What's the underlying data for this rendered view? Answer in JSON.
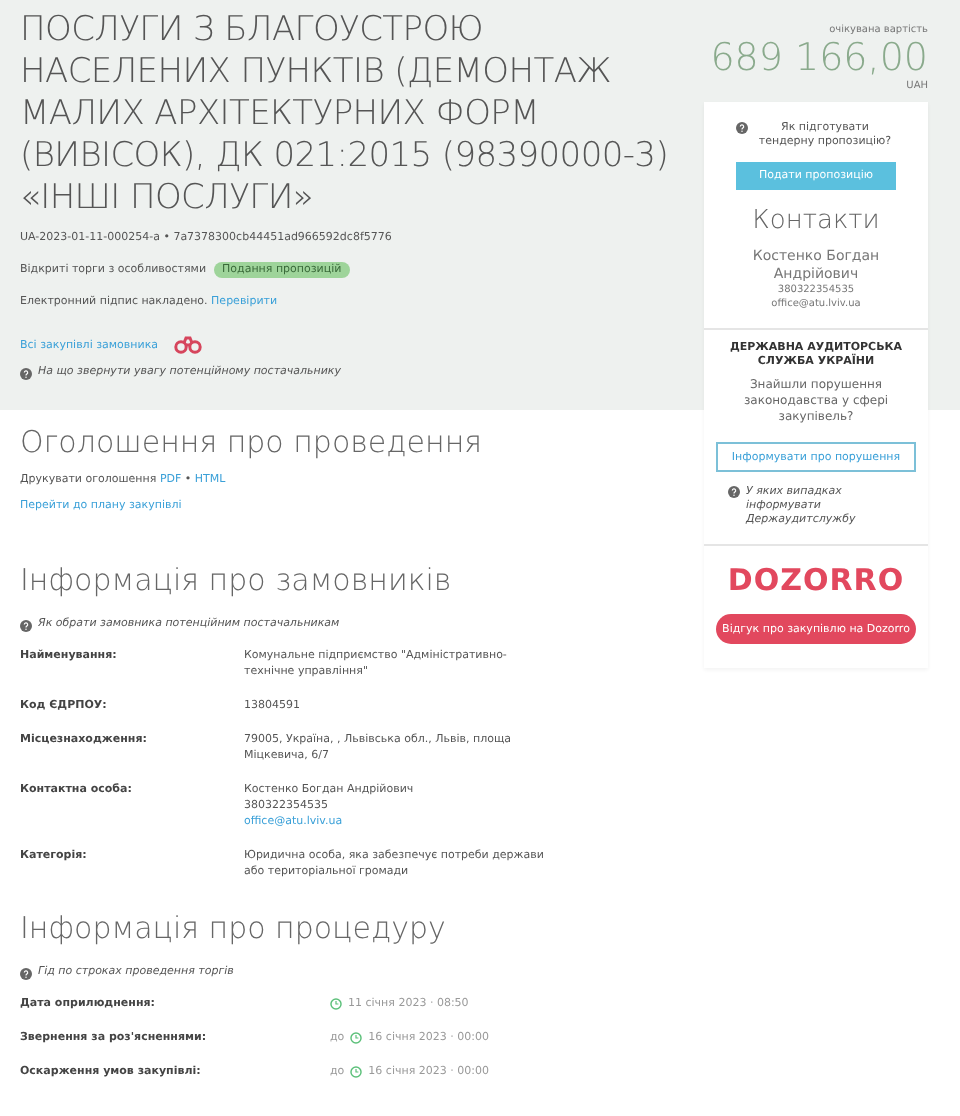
{
  "header": {
    "title": "ПОСЛУГИ З БЛАГОУСТРОЮ НАСЕЛЕНИХ ПУНКТІВ (ДЕМОНТАЖ МАЛИХ АРХІТЕКТУРНИХ ФОРМ (ВИВІСОК), ДК 021:2015 (98390000-3) «ІНШІ ПОСЛУГИ»",
    "tender_id": "UA-2023-01-11-000254-a • 7a7378300cb44451ad966592dc8f5776",
    "procedure_type": "Відкриті торги з особливостями",
    "status_badge": "Подання пропозицій",
    "signature_text": "Електронний підпис накладено.",
    "signature_link": "Перевірити",
    "buyer_link": "Всі закупівлі замовника",
    "attention_note": "На що звернути увагу потенційному постачальнику"
  },
  "sidebar": {
    "price_label": "очікувана вартість",
    "price": "689 166,00",
    "currency": "UAH",
    "help_text": "Як підготувати тендерну пропозицію?",
    "submit_button": "Подати пропозицію",
    "contacts_title": "Контакти",
    "contact_name": "Костенко Богдан Андрійович",
    "contact_phone": "380322354535",
    "contact_email": "office@atu.lviv.ua",
    "audit_title": "ДЕРЖАВНА АУДИТОРСЬКА СЛУЖБА УКРАЇНИ",
    "audit_question": "Знайшли порушення законодавства у сфері закупівель?",
    "report_button": "Інформувати про порушення",
    "audit_note": "У яких випадках інформувати Держаудитслужбу",
    "dozorro_logo": "DOZORRO",
    "review_button": "Відгук про закупівлю на Dozorro"
  },
  "announcement": {
    "heading": "Оголошення про проведення",
    "print_label": "Друкувати оголошення",
    "print_links": [
      "PDF",
      "HTML"
    ],
    "print_separator": "•",
    "plan_link": "Перейти до плану закупівлі"
  },
  "buyers": {
    "heading": "Інформація про замовників",
    "note": "Як обрати замовника потенційним постачальникам",
    "rows": [
      {
        "label": "Найменування:",
        "lines": [
          {
            "kind": "text",
            "text": "Комунальне підприємство \"Адміністративно-технічне управління\""
          }
        ]
      },
      {
        "label": "Код ЄДРПОУ:",
        "lines": [
          {
            "kind": "text",
            "text": "13804591"
          }
        ]
      },
      {
        "label": "Місцезнаходження:",
        "lines": [
          {
            "kind": "text",
            "text": "79005, Україна, , Львівська обл., Львів, площа Міцкевича, 6/7"
          }
        ]
      },
      {
        "label": "Контактна особа:",
        "lines": [
          {
            "kind": "text",
            "text": "Костенко Богдан Андрійович"
          },
          {
            "kind": "text",
            "text": "380322354535"
          },
          {
            "kind": "link",
            "text": "office@atu.lviv.ua"
          }
        ]
      },
      {
        "label": "Категорія:",
        "lines": [
          {
            "kind": "text",
            "text": "Юридична особа, яка забезпечує потреби держави або територіальної громади"
          }
        ]
      }
    ]
  },
  "procedure": {
    "heading": "Інформація про процедуру",
    "note": "Гід по строках проведення торгів",
    "rows": [
      {
        "label": "Дата оприлюднення:",
        "date": "11 січня 2023 · 08:50"
      },
      {
        "label": "Звернення за роз'ясненнями:",
        "prefix": "до",
        "date": "16 січня 2023 · 00:00"
      },
      {
        "label": "Оскарження умов закупівлі:",
        "prefix": "до",
        "date": "16 січня 2023 · 00:00"
      }
    ]
  }
}
